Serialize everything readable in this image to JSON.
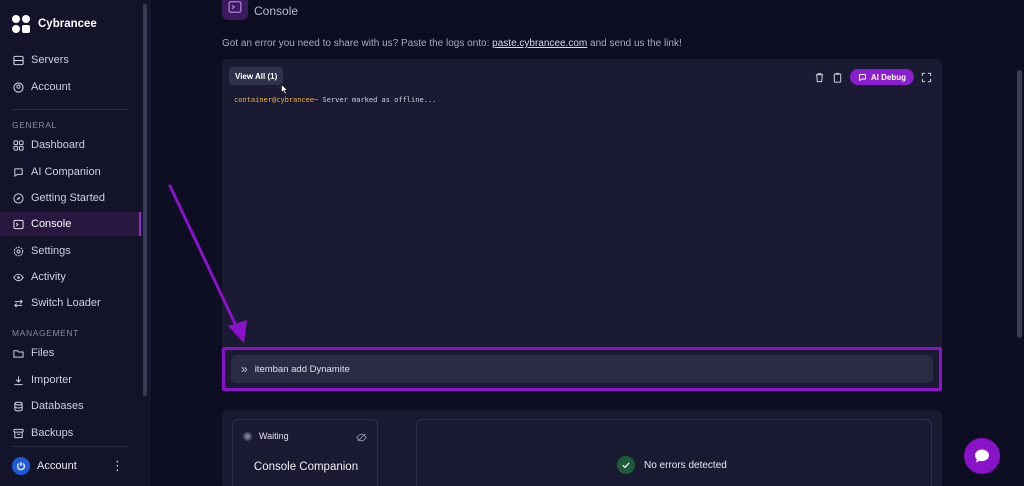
{
  "brand": {
    "name": "Cybrancee"
  },
  "sidebar": {
    "top_items": [
      {
        "label": "Servers",
        "icon": "server-icon"
      },
      {
        "label": "Account",
        "icon": "user-circle-icon"
      }
    ],
    "general_label": "GENERAL",
    "general_items": [
      {
        "label": "Dashboard",
        "icon": "grid-icon"
      },
      {
        "label": "AI Companion",
        "icon": "chat-icon"
      },
      {
        "label": "Getting Started",
        "icon": "compass-icon"
      },
      {
        "label": "Console",
        "icon": "terminal-icon",
        "active": true
      },
      {
        "label": "Settings",
        "icon": "gear-icon"
      },
      {
        "label": "Activity",
        "icon": "eye-icon"
      },
      {
        "label": "Switch Loader",
        "icon": "swap-icon"
      }
    ],
    "management_label": "MANAGEMENT",
    "management_items": [
      {
        "label": "Files",
        "icon": "folder-icon"
      },
      {
        "label": "Importer",
        "icon": "download-icon"
      },
      {
        "label": "Databases",
        "icon": "database-icon"
      },
      {
        "label": "Backups",
        "icon": "archive-icon"
      }
    ],
    "account_label": "Account"
  },
  "page": {
    "title": "Console",
    "info_prefix": "Got an error you need to share with us? Paste the logs onto: ",
    "info_link": "paste.cybrancee.com",
    "info_suffix": " and send us the link!"
  },
  "console": {
    "view_all_label": "View All (1)",
    "ai_debug_label": "AI Debug",
    "log_prompt": "container@cybrancee~",
    "log_text": " Server marked as offline...",
    "command_value": "itemban add Dynamite"
  },
  "companion": {
    "status": "Waiting",
    "title": "Console Companion",
    "errors_text": "No errors detected"
  },
  "colors": {
    "accent": "#8a12c8",
    "background": "#0e0e22",
    "card": "#1a1b33",
    "prompt": "#f0b23a"
  }
}
